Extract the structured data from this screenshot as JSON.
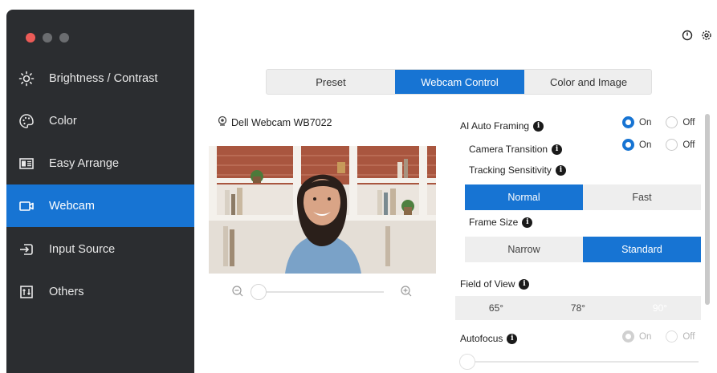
{
  "sidebar": {
    "items": [
      {
        "label": "Brightness / Contrast",
        "icon": "sun-icon"
      },
      {
        "label": "Color",
        "icon": "palette-icon"
      },
      {
        "label": "Easy Arrange",
        "icon": "layout-icon"
      },
      {
        "label": "Webcam",
        "icon": "webcam-icon",
        "active": true
      },
      {
        "label": "Input Source",
        "icon": "input-icon"
      },
      {
        "label": "Others",
        "icon": "others-icon"
      }
    ]
  },
  "tabs": [
    {
      "label": "Preset"
    },
    {
      "label": "Webcam Control",
      "active": true
    },
    {
      "label": "Color and Image"
    }
  ],
  "camera": {
    "name": "Dell Webcam WB7022"
  },
  "settings": {
    "ai_auto_framing": {
      "label": "AI Auto Framing",
      "on": "On",
      "off": "Off",
      "value": "On"
    },
    "camera_transition": {
      "label": "Camera Transition",
      "on": "On",
      "off": "Off",
      "value": "On"
    },
    "tracking_sensitivity": {
      "label": "Tracking Sensitivity",
      "options": [
        "Normal",
        "Fast"
      ],
      "selected": "Normal"
    },
    "frame_size": {
      "label": "Frame Size",
      "options": [
        "Narrow",
        "Standard"
      ],
      "selected": "Standard"
    },
    "field_of_view": {
      "label": "Field of View",
      "options": [
        "65°",
        "78°",
        "90°"
      ]
    },
    "autofocus": {
      "label": "Autofocus",
      "on": "On",
      "off": "Off",
      "value": "On"
    }
  },
  "colors": {
    "accent": "#1774d3",
    "sidebar_bg": "#2b2d30"
  }
}
